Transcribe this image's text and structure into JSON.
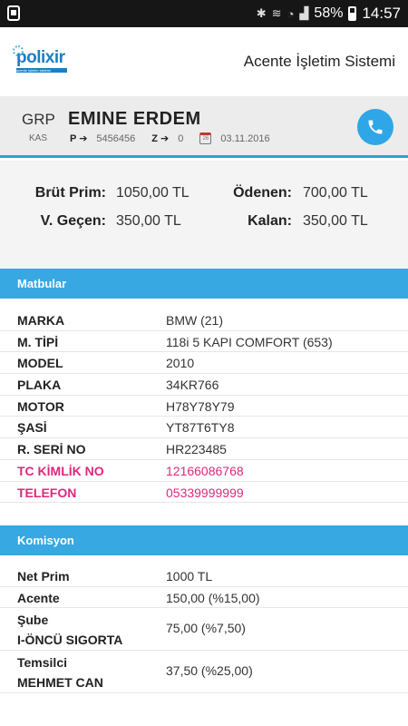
{
  "status": {
    "battery": "58%",
    "time": "14:57"
  },
  "header": {
    "logo_text": "polixir",
    "logo_tagline": "acente işletim sistemi",
    "title": "Acente İşletim Sistemi"
  },
  "customer": {
    "code": "GRP",
    "sub_code": "KAS",
    "name": "EMINE ERDEM",
    "p_label": "P",
    "p_value": "5456456",
    "z_label": "Z",
    "z_value": "0",
    "calendar_day": "26",
    "date": "03.11.2016"
  },
  "summary": {
    "brut_prim_label": "Brüt Prim:",
    "brut_prim_value": "1050,00 TL",
    "odenen_label": "Ödenen:",
    "odenen_value": "700,00 TL",
    "v_gecen_label": "V. Geçen:",
    "v_gecen_value": "350,00 TL",
    "kalan_label": "Kalan:",
    "kalan_value": "350,00 TL"
  },
  "matbular": {
    "title": "Matbular",
    "rows": [
      {
        "key": "MARKA",
        "value": "BMW (21)"
      },
      {
        "key": "M. TİPİ",
        "value": "118i 5 KAPI COMFORT (653)"
      },
      {
        "key": "MODEL",
        "value": "2010"
      },
      {
        "key": "PLAKA",
        "value": "34KR766"
      },
      {
        "key": "MOTOR",
        "value": "H78Y78Y79"
      },
      {
        "key": "ŞASİ",
        "value": "YT87T6TY8"
      },
      {
        "key": "R. SERİ NO",
        "value": "HR223485"
      },
      {
        "key": "TC KİMLİK NO",
        "value": "12166086768"
      },
      {
        "key": "TELEFON",
        "value": "05339999999"
      }
    ]
  },
  "komisyon": {
    "title": "Komisyon",
    "rows": [
      {
        "key": "Net Prim",
        "value": "1000 TL"
      },
      {
        "key": "Acente",
        "value": "150,00 (%15,00)"
      },
      {
        "key_line1": "Şube",
        "key_line2": "I-ÖNCÜ SIGORTA",
        "value": "75,00 (%7,50)"
      },
      {
        "key_line1": "Temsilci",
        "key_line2": "MEHMET CAN",
        "value": "37,50 (%25,00)"
      }
    ]
  },
  "colors": {
    "accent": "#37a8e2",
    "highlight": "#e0267d"
  },
  "icons": {
    "call": "phone-icon"
  }
}
